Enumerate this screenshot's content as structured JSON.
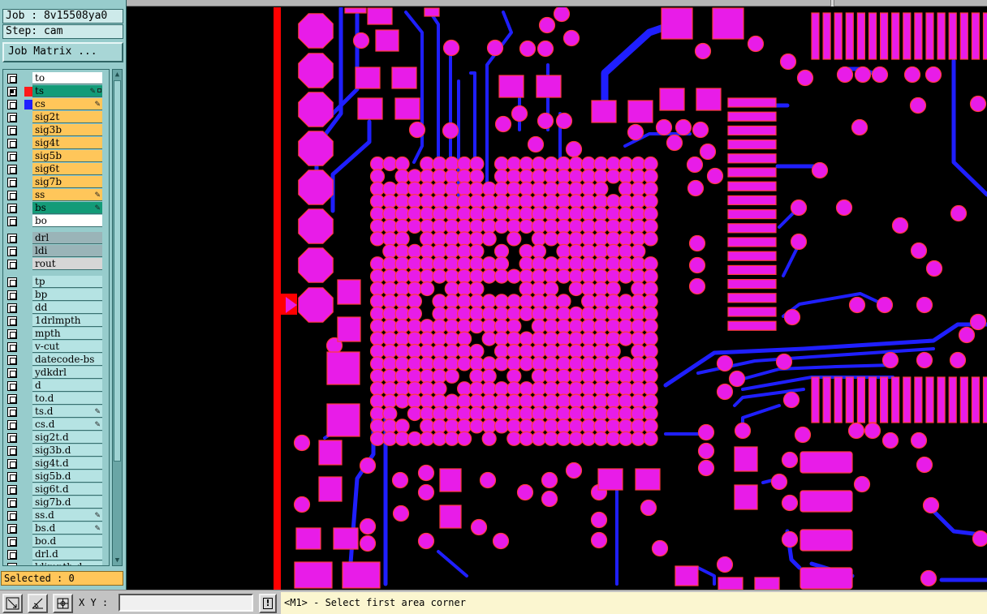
{
  "colors": {
    "pad": "#e81ce8",
    "pad_outline": "#ff3b3b",
    "trace": "#1f1fff",
    "board_edge": "#ff0000",
    "signal_layer": "#ffc65a",
    "board_layer": "#ffffff",
    "ts_layer": "#139b78",
    "drill_layer": "#9ab4b8",
    "rout_layer": "#d6d6d6",
    "misc_layer": "#b5e3e3",
    "selected_box": "#ffc65a"
  },
  "job": {
    "label": "Job : 8v15508ya0"
  },
  "step": {
    "label": "Step: cam"
  },
  "matrix_button": {
    "label": "Job Matrix ..."
  },
  "layers": {
    "board_group": [
      {
        "name": "to",
        "color": "#ffffff",
        "swatch": "",
        "mark": ""
      },
      {
        "name": "ts",
        "color": "#139b78",
        "swatch": "#ff1a1a",
        "mark": "edit+box",
        "checked_marker": true
      },
      {
        "name": "cs",
        "color": "#ffc65a",
        "swatch": "#1f1fff",
        "mark": "edit"
      },
      {
        "name": "sig2t",
        "color": "#ffc65a",
        "swatch": "",
        "mark": ""
      },
      {
        "name": "sig3b",
        "color": "#ffc65a",
        "swatch": "",
        "mark": ""
      },
      {
        "name": "sig4t",
        "color": "#ffc65a",
        "swatch": "",
        "mark": ""
      },
      {
        "name": "sig5b",
        "color": "#ffc65a",
        "swatch": "",
        "mark": ""
      },
      {
        "name": "sig6t",
        "color": "#ffc65a",
        "swatch": "",
        "mark": ""
      },
      {
        "name": "sig7b",
        "color": "#ffc65a",
        "swatch": "",
        "mark": ""
      },
      {
        "name": "ss",
        "color": "#ffc65a",
        "swatch": "",
        "mark": "edit"
      },
      {
        "name": "bs",
        "color": "#139b78",
        "swatch": "",
        "mark": "edit"
      },
      {
        "name": "bo",
        "color": "#ffffff",
        "swatch": "",
        "mark": ""
      }
    ],
    "drill_group": [
      {
        "name": "drl",
        "color": "#9ab4b8",
        "swatch": "",
        "mark": ""
      },
      {
        "name": "ldi",
        "color": "#9ab4b8",
        "swatch": "",
        "mark": ""
      },
      {
        "name": "rout",
        "color": "#d6d6d6",
        "swatch": "",
        "mark": ""
      }
    ],
    "misc_group": [
      {
        "name": "tp",
        "mark": ""
      },
      {
        "name": "bp",
        "mark": ""
      },
      {
        "name": "dd",
        "mark": ""
      },
      {
        "name": "1drlmpth",
        "mark": ""
      },
      {
        "name": "mpth",
        "mark": ""
      },
      {
        "name": "v-cut",
        "mark": ""
      },
      {
        "name": "datecode-bs",
        "mark": ""
      },
      {
        "name": "ydkdrl",
        "mark": ""
      },
      {
        "name": "d",
        "mark": ""
      },
      {
        "name": "to.d",
        "mark": ""
      },
      {
        "name": "ts.d",
        "mark": "edit"
      },
      {
        "name": "cs.d",
        "mark": "edit"
      },
      {
        "name": "sig2t.d",
        "mark": ""
      },
      {
        "name": "sig3b.d",
        "mark": ""
      },
      {
        "name": "sig4t.d",
        "mark": ""
      },
      {
        "name": "sig5b.d",
        "mark": ""
      },
      {
        "name": "sig6t.d",
        "mark": ""
      },
      {
        "name": "sig7b.d",
        "mark": ""
      },
      {
        "name": "ss.d",
        "mark": "edit"
      },
      {
        "name": "bs.d",
        "mark": "edit"
      },
      {
        "name": "bo.d",
        "mark": ""
      },
      {
        "name": "drl.d",
        "mark": ""
      },
      {
        "name": "ldimpth.d",
        "mark": ""
      }
    ]
  },
  "selected": {
    "label": "Selected : 0"
  },
  "status_bar": {
    "xy_label": "X Y :",
    "xy_value": "",
    "warn_label": "!",
    "prompt": "<M1> - Select first area corner",
    "tools": [
      "zoom-area-icon",
      "measure-icon",
      "snap-grid-icon"
    ]
  }
}
